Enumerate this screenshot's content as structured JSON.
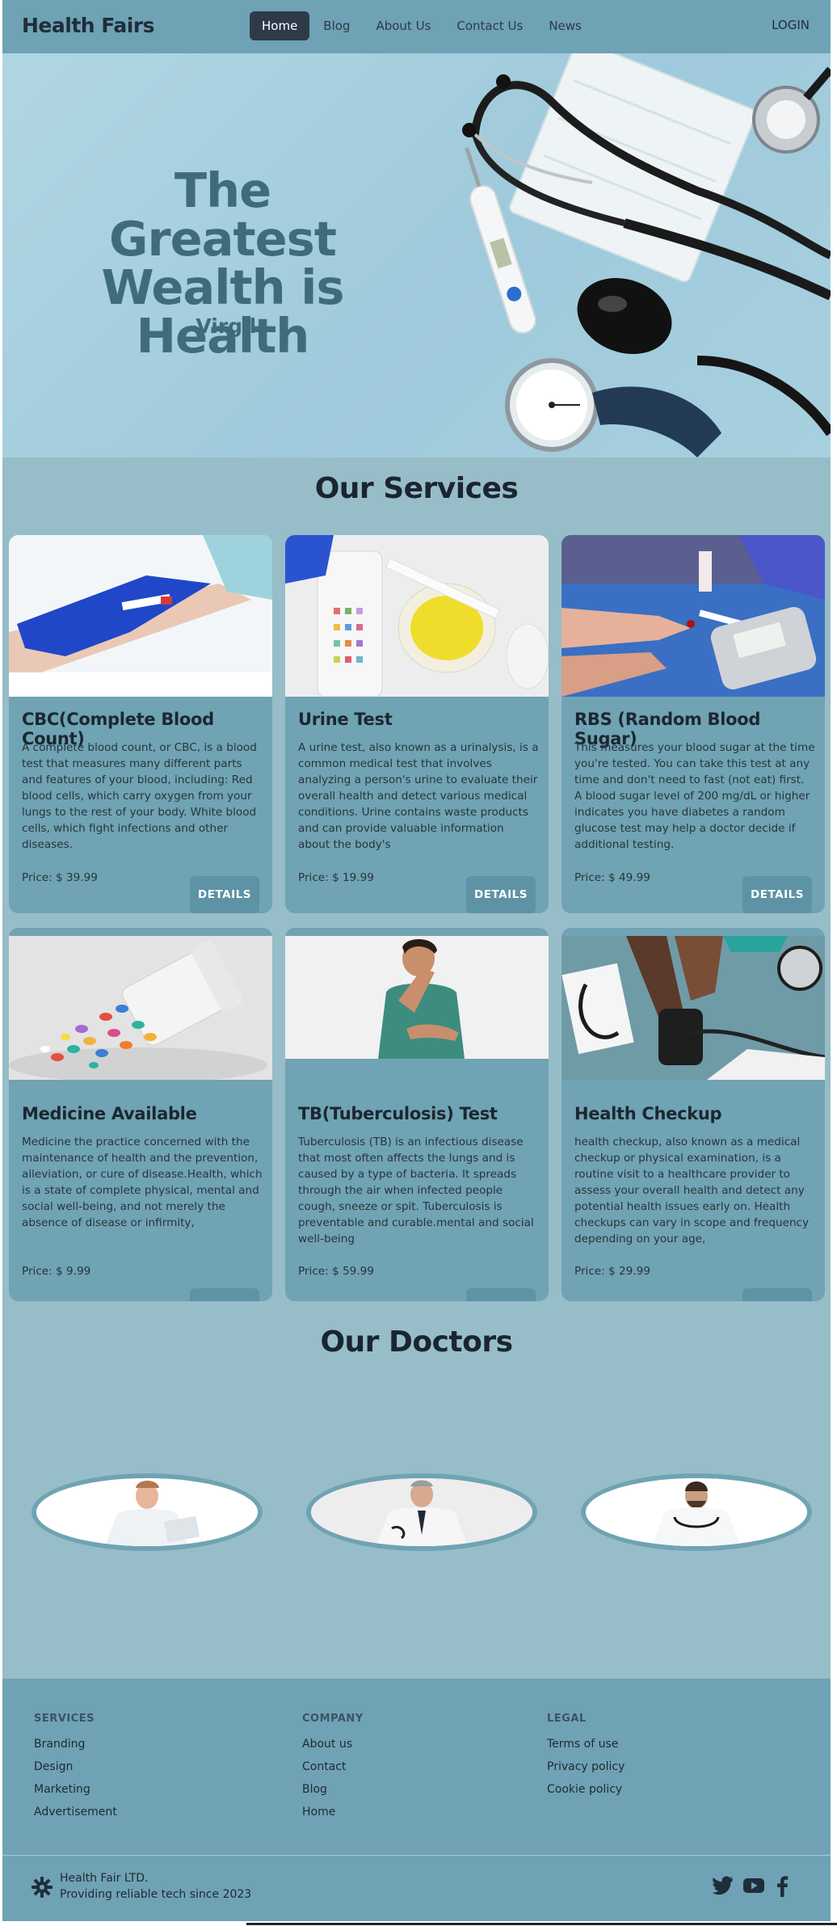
{
  "nav": {
    "brand": "Health Fairs",
    "links": [
      "Home",
      "Blog",
      "About Us",
      "Contact Us",
      "News"
    ],
    "active": "Home",
    "login": "LOGIN"
  },
  "hero": {
    "quote_lines": [
      "The",
      "Greatest",
      "Wealth is Health"
    ],
    "author": "-Virgil"
  },
  "services": {
    "title": "Our Services",
    "button_label": "DETAILS",
    "items": [
      {
        "title": "CBC(Complete Blood Count)",
        "description": "A complete blood count, or CBC, is a blood test that measures many different parts and features of your blood, including: Red blood cells, which carry oxygen from your lungs to the rest of your body. White blood cells, which fight infections and other diseases.",
        "price": "Price: $ 39.99"
      },
      {
        "title": "Urine Test",
        "description": "A urine test, also known as a urinalysis, is a common medical test that involves analyzing a person's urine to evaluate their overall health and detect various medical conditions. Urine contains waste products and can provide valuable information about the body's",
        "price": "Price: $ 19.99"
      },
      {
        "title": "RBS (Random Blood Sugar)",
        "description": "This measures your blood sugar at the time you're tested. You can take this test at any time and don't need to fast (not eat) first. A blood sugar level of 200 mg/dL or higher indicates you have diabetes a random glucose test may help a doctor decide if additional testing.",
        "price": "Price: $ 49.99"
      },
      {
        "title": "Medicine Available",
        "description": "Medicine the practice concerned with the maintenance of health and the prevention, alleviation, or cure of disease.Health, which is a state of complete physical, mental and social well-being, and not merely the absence of disease or infirmity,",
        "price": "Price: $ 9.99"
      },
      {
        "title": "TB(Tuberculosis) Test",
        "description": "Tuberculosis (TB) is an infectious disease that most often affects the lungs and is caused by a type of bacteria. It spreads through the air when infected people cough, sneeze or spit. Tuberculosis is preventable and curable.mental and social well-being",
        "price": "Price: $ 59.99"
      },
      {
        "title": "Health Checkup",
        "description": "health checkup, also known as a medical checkup or physical examination, is a routine visit to a healthcare provider to assess your overall health and detect any potential health issues early on. Health checkups can vary in scope and frequency depending on your age,",
        "price": "Price: $ 29.99"
      }
    ]
  },
  "doctors": {
    "title": "Our Doctors"
  },
  "footer": {
    "services": {
      "heading": "SERVICES",
      "links": [
        "Branding",
        "Design",
        "Marketing",
        "Advertisement"
      ]
    },
    "company": {
      "heading": "COMPANY",
      "links": [
        "About us",
        "Contact",
        "Blog",
        "Home"
      ]
    },
    "legal": {
      "heading": "LEGAL",
      "links": [
        "Terms of use",
        "Privacy policy",
        "Cookie policy"
      ]
    },
    "company_name": "Health Fair LTD.",
    "tagline": "Providing reliable tech since 2023",
    "social_icons": [
      "twitter-icon",
      "youtube-icon",
      "facebook-icon"
    ]
  },
  "colors": {
    "page_bg": "#97bdc8",
    "nav_bg": "#6ea2b4",
    "card_bg": "#70a3b3",
    "button_bg": "#5e93a5",
    "active_nav": "#2f3a48",
    "heading_teal": "#3f6c7b"
  }
}
